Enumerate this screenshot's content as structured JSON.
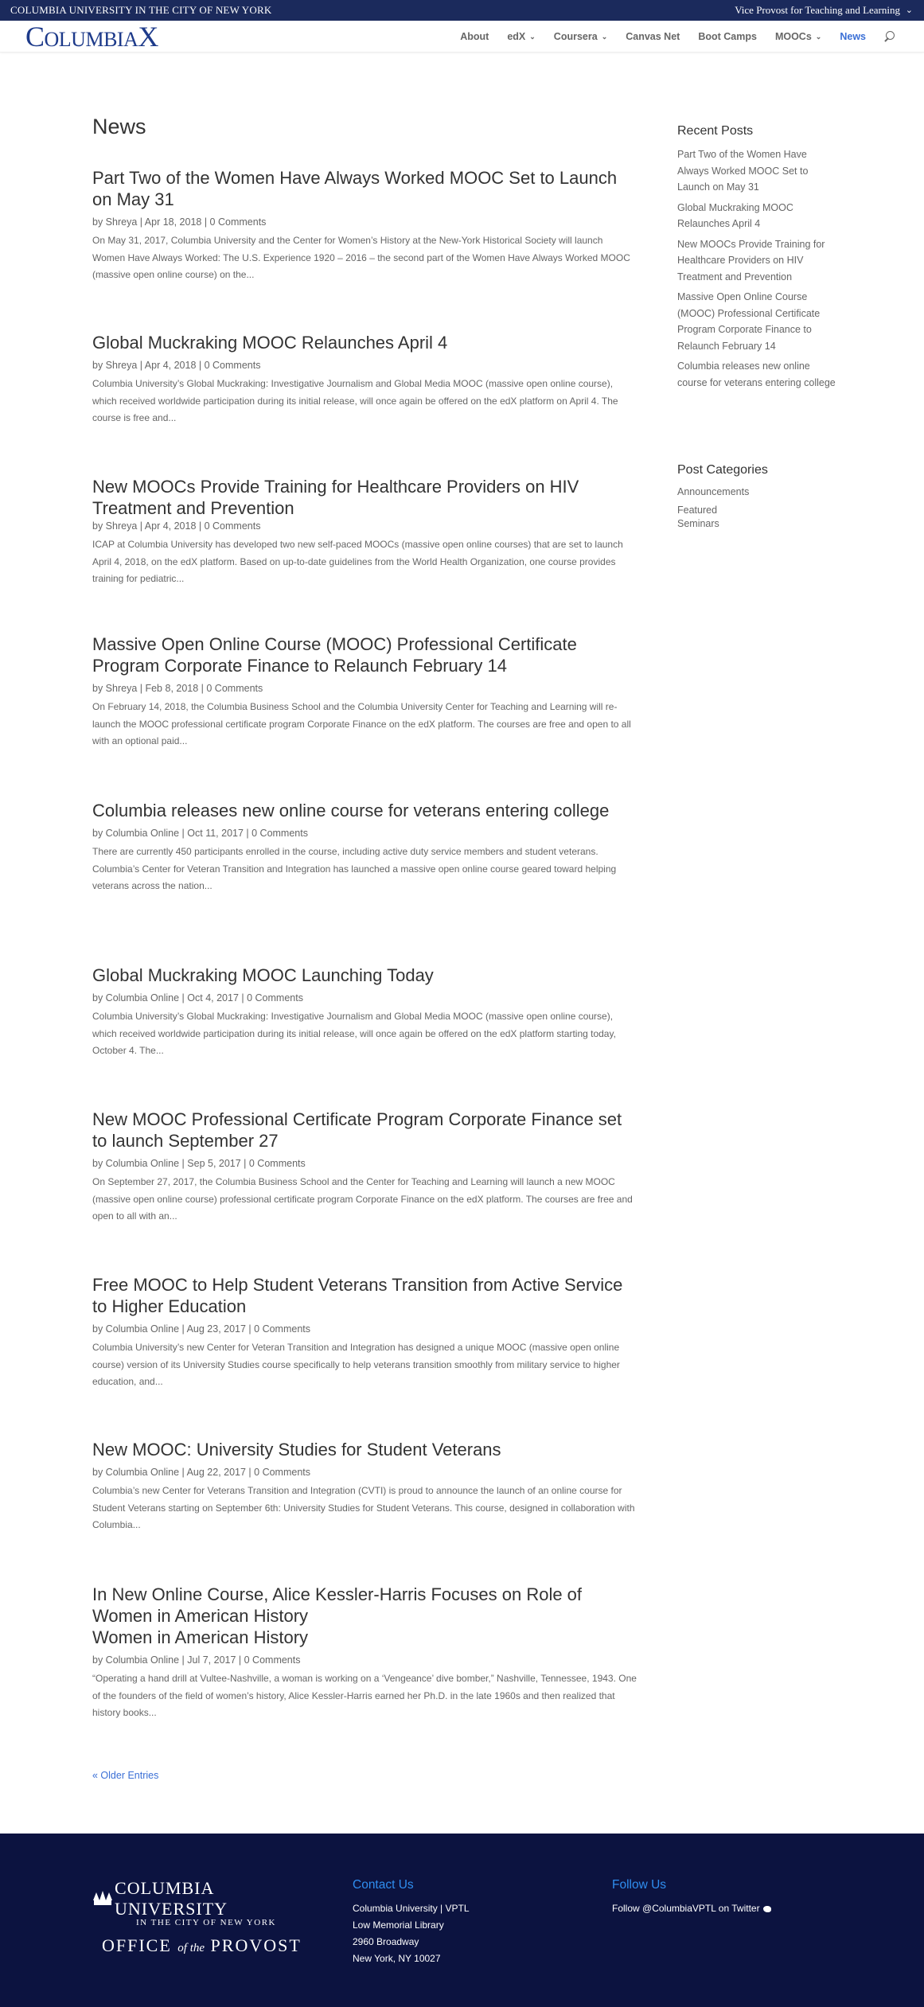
{
  "topbar": {
    "university": "COLUMBIA UNIVERSITY IN THE CITY OF NEW YORK",
    "office": "Vice Provost for Teaching and Learning"
  },
  "header": {
    "logo_big_c": "C",
    "logo_mid": "OLUMBIA",
    "logo_x": "X",
    "nav": [
      {
        "label": "About",
        "dropdown": false
      },
      {
        "label": "edX",
        "dropdown": true
      },
      {
        "label": "Coursera",
        "dropdown": true
      },
      {
        "label": "Canvas Net",
        "dropdown": false
      },
      {
        "label": "Boot Camps",
        "dropdown": false
      },
      {
        "label": "MOOCs",
        "dropdown": true
      },
      {
        "label": "News",
        "dropdown": false,
        "active": true
      }
    ],
    "accent_color": "#3a6fd6"
  },
  "main": {
    "title": "News",
    "posts": [
      {
        "title": "Part Two of the Women Have Always Worked MOOC Set to Launch on May 31",
        "meta": "by Shreya | Apr 18, 2018 | 0 Comments",
        "excerpt": "On May 31, 2017, Columbia University and the Center for Women’s History at the New-York Historical Society will launch Women Have Always Worked: The U.S. Experience 1920 – 2016 – the second part of the Women Have Always Worked MOOC (massive open online course) on the..."
      },
      {
        "title": "Global Muckraking MOOC Relaunches April 4",
        "meta": "by Shreya | Apr 4, 2018 | 0 Comments",
        "excerpt": "Columbia University’s Global Muckraking: Investigative Journalism and Global Media MOOC (massive open online course), which received worldwide participation during its initial release, will once again be offered on the edX platform on April 4. The course is free and..."
      },
      {
        "title": "New MOOCs Provide Training for Healthcare Providers on HIV Treatment and Prevention",
        "meta": "by Shreya | Apr 4, 2018 | 0 Comments",
        "excerpt": "ICAP at Columbia University has developed two new self-paced MOOCs (massive open online courses) that are set to launch April 4, 2018, on the edX platform. Based on up-to-date guidelines from the World Health Organization, one course provides training for pediatric..."
      },
      {
        "title": "Massive Open Online Course (MOOC) Professional Certificate Program Corporate Finance to Relaunch February 14",
        "meta": "by Shreya | Feb 8, 2018 | 0 Comments",
        "excerpt": "On February 14, 2018, the Columbia Business School and the Columbia University Center for Teaching and Learning will re-launch the MOOC professional certificate program Corporate Finance on the edX platform. The courses are free and open to all with an optional paid..."
      },
      {
        "title": "Columbia releases new online course for veterans entering college",
        "meta": "by Columbia Online | Oct 11, 2017 | 0 Comments",
        "excerpt": "There are currently 450 participants enrolled in the course, including active duty service members and student veterans. Columbia’s Center for Veteran Transition and Integration has launched a massive open online course geared toward helping veterans across the nation..."
      },
      {
        "title": "Global Muckraking MOOC Launching Today",
        "meta": "by Columbia Online | Oct 4, 2017 | 0 Comments",
        "excerpt": "Columbia University’s Global Muckraking: Investigative Journalism and Global Media MOOC (massive open online course), which received worldwide participation during its initial release, will once again be offered on the edX platform starting today, October 4. The..."
      },
      {
        "title": "New MOOC Professional Certificate Program Corporate Finance set to launch September 27",
        "meta": "by Columbia Online | Sep 5, 2017 | 0 Comments",
        "excerpt": "On September 27, 2017, the Columbia Business School and the Center for Teaching and Learning will launch a new MOOC (massive open online course) professional certificate program Corporate Finance on the edX platform. The courses are free and open to all with an..."
      },
      {
        "title": "Free MOOC to Help Student Veterans Transition from Active Service to Higher Education",
        "meta": "by Columbia Online | Aug 23, 2017 | 0 Comments",
        "excerpt": "Columbia University’s new Center for Veteran Transition and Integration has designed a unique MOOC (massive open online course) version of its University Studies course specifically to help veterans transition smoothly from military service to higher education, and..."
      },
      {
        "title": "New MOOC: University Studies for Student Veterans",
        "meta": "by Columbia Online | Aug 22, 2017 | 0 Comments",
        "excerpt": "Columbia’s new Center for Veterans Transition and Integration (CVTI) is proud to announce the launch of an online course for Student Veterans starting on September 6th:  University Studies for Student Veterans. This course, designed in collaboration with Columbia..."
      },
      {
        "title": "In New Online Course, Alice Kessler-Harris Focuses on Role of Women in American History\nWomen in American History",
        "meta": "by Columbia Online | Jul 7, 2017 | 0 Comments",
        "excerpt": "“Operating a hand drill at Vultee-Nashville, a woman is working on a ‘Vengeance’ dive bomber,” Nashville, Tennessee, 1943. One of the founders of the field of women’s history, Alice Kessler-Harris earned her Ph.D. in the late 1960s and then realized that history books..."
      }
    ],
    "older_entries": "« Older Entries"
  },
  "sidebar": {
    "recent_title": "Recent Posts",
    "recent": [
      "Part Two of the Women Have Always Worked MOOC Set to Launch on May 31",
      "Global Muckraking MOOC Relaunches April 4",
      "New MOOCs Provide Training for Healthcare Providers on HIV Treatment and Prevention",
      "Massive Open Online Course (MOOC) Professional Certificate Program Corporate Finance to Relaunch February 14",
      "Columbia releases new online course for veterans entering college"
    ],
    "categories_title": "Post Categories",
    "categories": [
      "Announcements",
      "Featured\nSeminars"
    ]
  },
  "footer": {
    "cu_name": "COLUMBIA UNIVERSITY",
    "cu_sub": "IN THE CITY OF NEW YORK",
    "provost_office": "OFFICE",
    "provost_of_the": "of the",
    "provost_name": "PROVOST",
    "contact_title": "Contact Us",
    "contact_lines": [
      "Columbia University | VPTL",
      "Low Memorial Library",
      "2960 Broadway",
      "New York, NY 10027"
    ],
    "follow_title": "Follow Us",
    "follow_text": "Follow @ColumbiaVPTL on Twitter"
  }
}
